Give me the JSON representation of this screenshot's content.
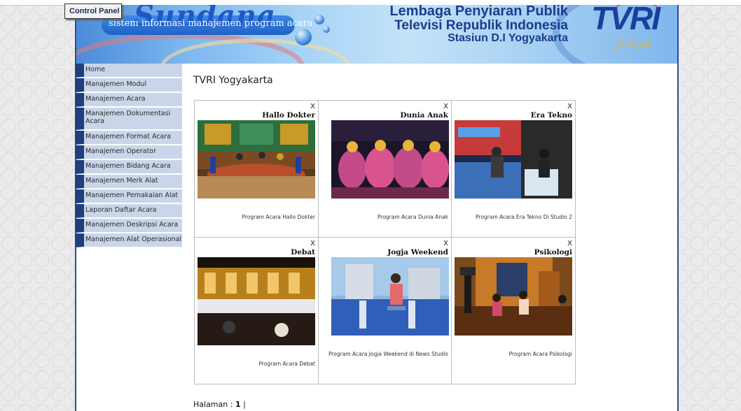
{
  "app": {
    "control_panel": "Control Panel",
    "brand_name": "Sundana",
    "tagline": "sistem informasi manajemen program acara",
    "org_line1": "Lembaga Penyiaran Publik",
    "org_line2": "Televisi Republik Indonesia",
    "org_line3": "Stasiun D.I Yogyakarta",
    "logo_text": "TVRI",
    "logo_sub": "JOGJA"
  },
  "sidebar": {
    "items": [
      {
        "label": "Home"
      },
      {
        "label": "Manajemen Modul"
      },
      {
        "label": "Manajemen Acara"
      },
      {
        "label": "Manajemen Dokumentasi Acara"
      },
      {
        "label": "Manajemen Format Acara"
      },
      {
        "label": "Manajemen Operator"
      },
      {
        "label": "Manajemen Bidang Acara"
      },
      {
        "label": "Manajemen Merk Alat"
      },
      {
        "label": "Manajemen Pemakaian Alat"
      },
      {
        "label": "Laporan Daftar Acara"
      },
      {
        "label": "Manajemen Deskripsi Acara"
      },
      {
        "label": "Manajemen Alat Operasional"
      }
    ]
  },
  "main": {
    "title": "TVRI Yogyakarta",
    "close_label": "X",
    "programs": [
      {
        "title": "Hallo Dokter",
        "description": "Program Acara Hallo Dokter"
      },
      {
        "title": "Dunia Anak",
        "description": "Program Acara Dunia Anak"
      },
      {
        "title": "Era Tekno",
        "description": "Program Acara Era Tekno Di Studio 2"
      },
      {
        "title": "Debat",
        "description": "Program Acara Debat"
      },
      {
        "title": "Jogja Weekend",
        "description": "Program Acara Jogja Weekend di News Studio"
      },
      {
        "title": "Psikologi",
        "description": "Program Acara Psikologi"
      }
    ],
    "pager": {
      "label": "Halaman :",
      "current": "1",
      "separator": "|"
    }
  }
}
